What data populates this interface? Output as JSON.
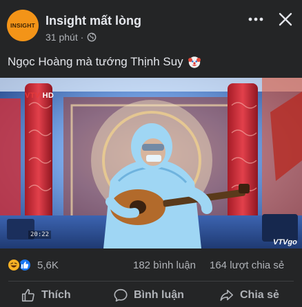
{
  "post": {
    "author": "Insight mất lòng",
    "avatar_text": "INSIGHT",
    "time": "31 phút ·",
    "caption": "Ngọc Hoàng mà tướng Thịnh Suy",
    "caption_emoji": "clown-face-emoji"
  },
  "video": {
    "channel_logo_prefix": "VTV",
    "channel_logo_suffix": "HD",
    "timecode": "20:22",
    "watermark": "VTVgo"
  },
  "stats": {
    "reactions_count": "5,6K",
    "reaction_icons": [
      "haha-icon",
      "like-icon"
    ],
    "comments": "182 bình luận",
    "shares": "164 lượt chia sẻ"
  },
  "actions": {
    "like_label": "Thích",
    "comment_label": "Bình luận",
    "share_label": "Chia sẻ"
  },
  "colors": {
    "background": "#242526",
    "avatar": "#f39418",
    "text_primary": "#e4e6eb",
    "text_secondary": "#b0b3b8",
    "like_blue": "#1877f2",
    "haha_yellow": "#f7b125"
  }
}
